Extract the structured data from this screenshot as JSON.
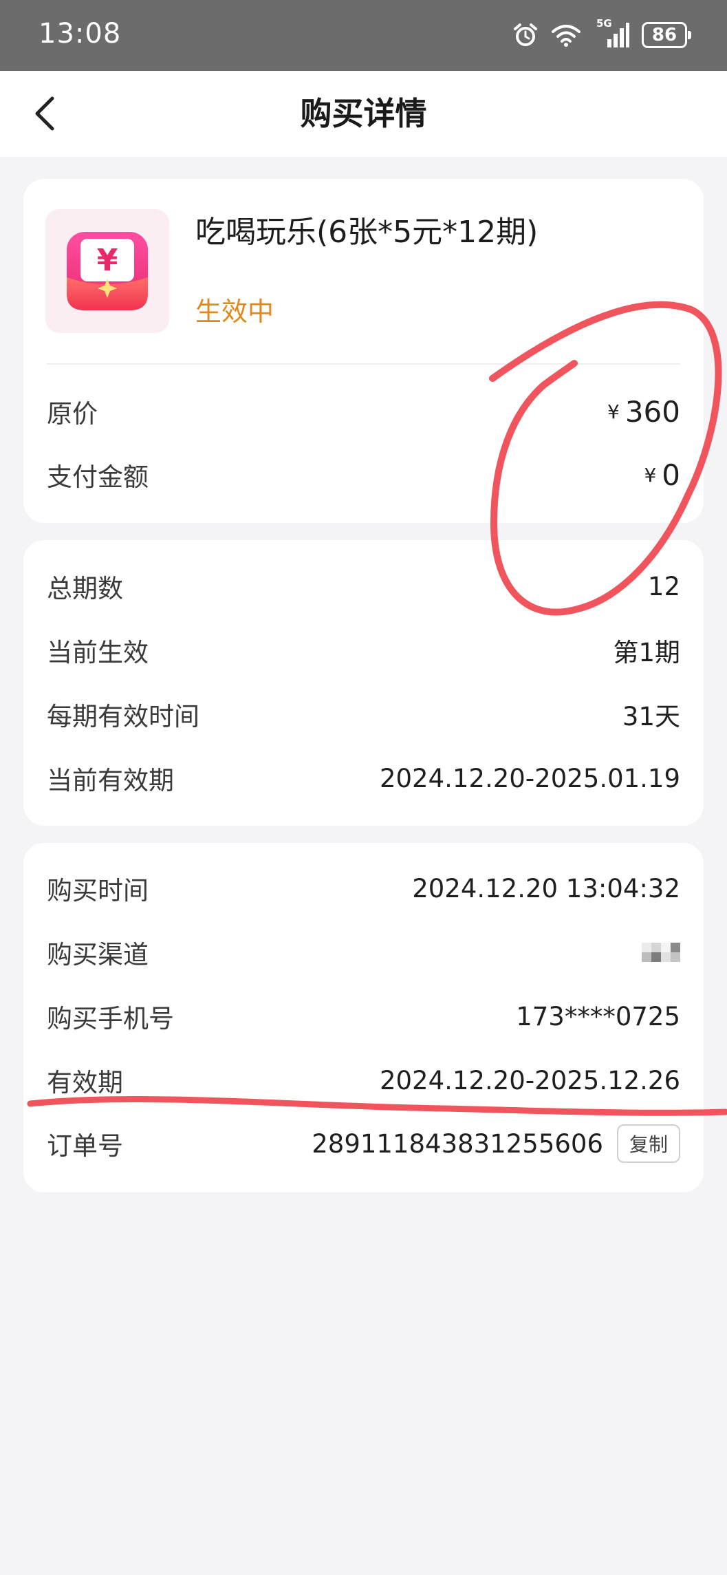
{
  "status_bar": {
    "time": "13:08",
    "network": "5G",
    "battery": "86",
    "icons": [
      "alarm-icon",
      "wifi-icon",
      "signal-icon",
      "battery-icon"
    ]
  },
  "nav": {
    "title": "购买详情",
    "back_icon": "chevron-left-icon"
  },
  "product": {
    "name": "吃喝玩乐(6张*5元*12期)",
    "status": "生效中",
    "status_color": "#e08a1e",
    "icon": "red-envelope-yuan-icon"
  },
  "price": {
    "original_label": "原价",
    "original_value": "360",
    "paid_label": "支付金额",
    "paid_value": "0",
    "currency": "¥"
  },
  "periods": {
    "total_label": "总期数",
    "total_value": "12",
    "current_label": "当前生效",
    "current_value": "第1期",
    "duration_label": "每期有效时间",
    "duration_value": "31天",
    "current_validity_label": "当前有效期",
    "current_validity_value": "2024.12.20-2025.01.19"
  },
  "purchase": {
    "time_label": "购买时间",
    "time_value": "2024.12.20 13:04:32",
    "channel_label": "购买渠道",
    "phone_label": "购买手机号",
    "phone_value": "173****0725",
    "validity_label": "有效期",
    "validity_value": "2024.12.20-2025.12.26",
    "order_label": "订单号",
    "order_value": "289111843831255606",
    "copy_label": "复制"
  },
  "annotation_color": "#f0545c"
}
